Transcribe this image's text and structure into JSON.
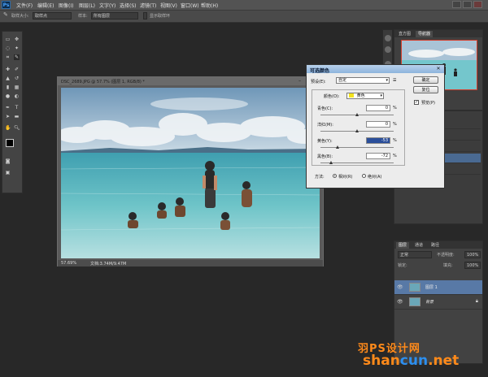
{
  "app": {
    "logo": "Ps"
  },
  "menu": {
    "items": [
      "文件(F)",
      "编辑(E)",
      "图像(I)",
      "图层(L)",
      "文字(Y)",
      "选择(S)",
      "滤镜(T)",
      "视图(V)",
      "窗口(W)",
      "帮助(H)"
    ]
  },
  "options_bar": {
    "tool_size_label": "取样大小:",
    "tool_size_value": "取样点",
    "sample_label": "样本:",
    "sample_value": "所有图层",
    "ring_label": "显示取样环"
  },
  "document": {
    "title": "DSC_2689.JPG @ 57.7% (图层 1, RGB/8) *",
    "zoom": "57.69%",
    "doc_size": "文档:3.74M/9.47M"
  },
  "navigator": {
    "tabs": [
      "直方图",
      "导航器"
    ],
    "active": 1
  },
  "layers": {
    "tabs": [
      "图层",
      "通道",
      "路径"
    ],
    "blend_mode": "正常",
    "opacity_label": "不透明度:",
    "opacity_value": "100%",
    "lock_label": "锁定:",
    "fill_label": "填充:",
    "fill_value": "100%",
    "rows": [
      {
        "name": "图层 1",
        "selected": true
      },
      {
        "name": "背景",
        "selected": false
      }
    ]
  },
  "dialog": {
    "title": "可选颜色",
    "preset_label": "预设(E):",
    "preset_value": "自定",
    "ok": "确定",
    "cancel": "复位",
    "preview_label": "预览(P)",
    "colors_label": "颜色(O):",
    "colors_value": "黄色",
    "colors_swatch": "#f2e21c",
    "sliders": [
      {
        "label": "青色(C):",
        "value": "0",
        "pct": 0
      },
      {
        "label": "洋红(M):",
        "value": "0",
        "pct": 0
      },
      {
        "label": "黄色(Y):",
        "value": "-53",
        "pct": -53
      },
      {
        "label": "黑色(B):",
        "value": "-72",
        "pct": -72
      }
    ],
    "method_label": "方法:",
    "method_relative": "相对(R)",
    "method_absolute": "绝对(A)"
  },
  "watermark": {
    "top": "羽PS设计网",
    "bottom": "shancun.net"
  },
  "colors": {
    "accent_red": "#d53d2a",
    "dialog_title": "#9fbfe2"
  }
}
